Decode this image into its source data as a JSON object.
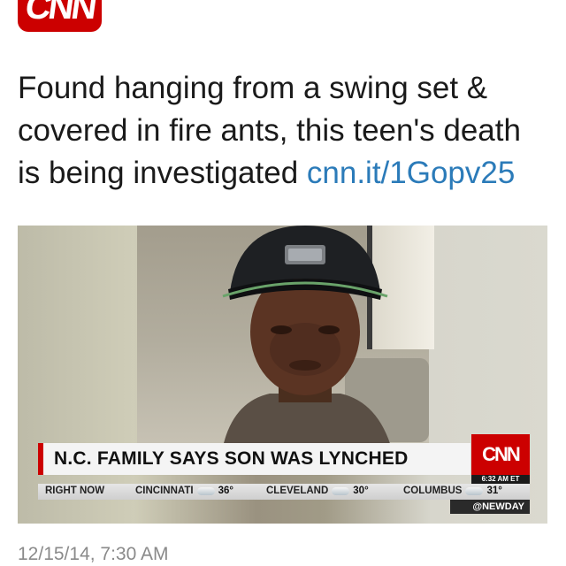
{
  "account": {
    "avatar_text": "CNN"
  },
  "tweet": {
    "text": "Found hanging from a swing set & covered in fire ants, this teen's death is being investigated",
    "link": "cnn.it/1Gopv25",
    "timestamp": "12/15/14, 7:30 AM"
  },
  "media": {
    "headline": "N.C. FAMILY SAYS SON WAS LYNCHED",
    "cnn_logo": "CNN",
    "time": "6:32 AM ET",
    "ticker": {
      "label": "RIGHT NOW",
      "items": [
        {
          "city": "CINCINNATI",
          "temp": "36°"
        },
        {
          "city": "CLEVELAND",
          "temp": "30°"
        },
        {
          "city": "COLUMBUS",
          "temp": "31°"
        }
      ]
    },
    "show_tag": "@NEWDAY"
  },
  "colors": {
    "brand": "#cc0000",
    "link": "#2b7bb9",
    "timestamp": "#8a8a8a"
  }
}
